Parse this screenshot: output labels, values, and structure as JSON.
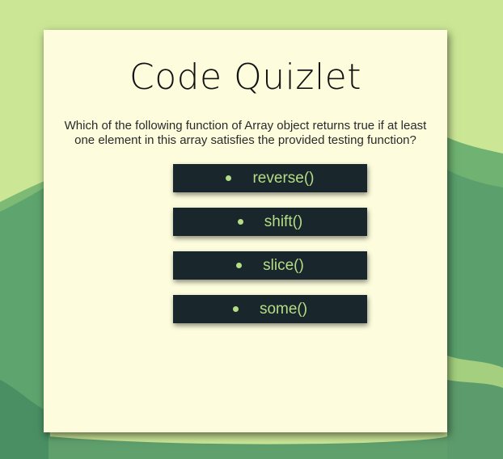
{
  "page": {
    "title": "Code Quizlet"
  },
  "quiz": {
    "question": "Which of the following function of Array object returns true if at least one element in this array satisfies the provided testing function?",
    "answers": [
      {
        "label": "reverse()"
      },
      {
        "label": "shift()"
      },
      {
        "label": "slice()"
      },
      {
        "label": "some()"
      }
    ]
  },
  "colors": {
    "background_light": "#cbe796",
    "card": "#fdfdde",
    "answer_bg": "#19262c",
    "answer_text": "#b5dd86",
    "hill_green": "#5ea46e"
  },
  "icons": {
    "bullet": "bullet-dot-icon"
  }
}
